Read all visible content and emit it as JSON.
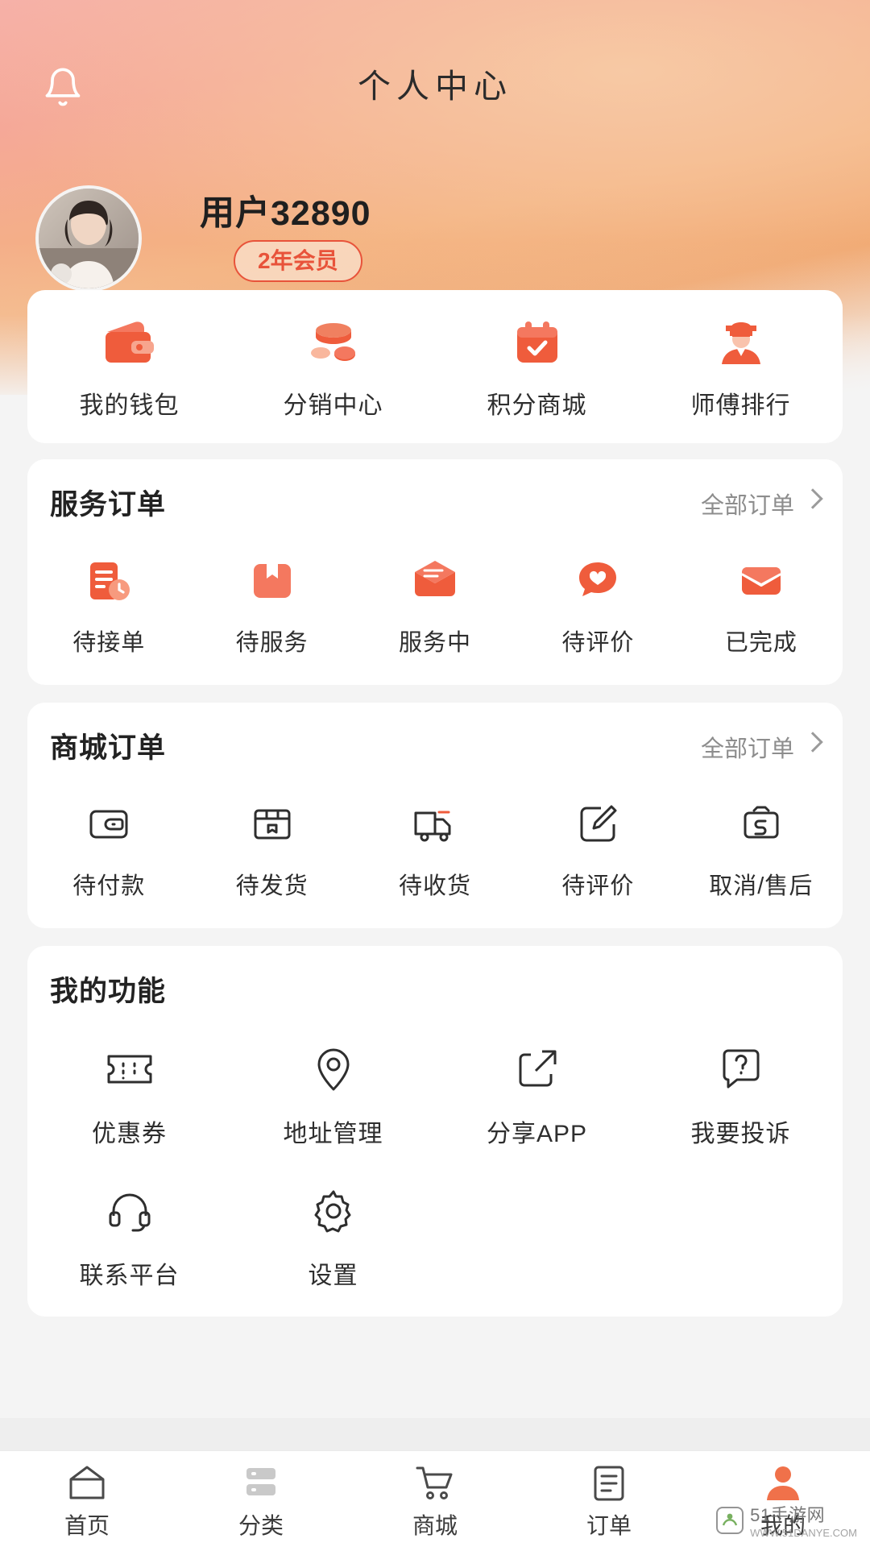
{
  "header": {
    "title": "个人中心",
    "bell_icon": "bell-icon",
    "accent_color": "#e8533a",
    "gradient_from": "#f6b1a8",
    "gradient_to": "#f0a56c"
  },
  "profile": {
    "avatar_icon": "user-avatar",
    "username": "用户32890",
    "badge": "2年会员"
  },
  "quick_actions": [
    {
      "label": "我的钱包",
      "icon": "wallet-icon"
    },
    {
      "label": "分销中心",
      "icon": "coins-icon"
    },
    {
      "label": "积分商城",
      "icon": "points-mall-icon"
    },
    {
      "label": "师傅排行",
      "icon": "worker-rank-icon"
    }
  ],
  "service_orders": {
    "title": "服务订单",
    "more_label": "全部订单",
    "chevron_icon": "chevron-right-icon",
    "items": [
      {
        "label": "待接单",
        "icon": "pending-accept-icon"
      },
      {
        "label": "待服务",
        "icon": "pending-service-icon"
      },
      {
        "label": "服务中",
        "icon": "in-service-icon"
      },
      {
        "label": "待评价",
        "icon": "pending-review-icon"
      },
      {
        "label": "已完成",
        "icon": "completed-icon"
      }
    ]
  },
  "mall_orders": {
    "title": "商城订单",
    "more_label": "全部订单",
    "chevron_icon": "chevron-right-icon",
    "items": [
      {
        "label": "待付款",
        "icon": "wallet-outline-icon"
      },
      {
        "label": "待发货",
        "icon": "package-outline-icon"
      },
      {
        "label": "待收货",
        "icon": "truck-outline-icon"
      },
      {
        "label": "待评价",
        "icon": "edit-outline-icon"
      },
      {
        "label": "取消/售后",
        "icon": "refund-outline-icon"
      }
    ]
  },
  "my_functions": {
    "title": "我的功能",
    "items": [
      {
        "label": "优惠券",
        "icon": "coupon-icon"
      },
      {
        "label": "地址管理",
        "icon": "location-pin-icon"
      },
      {
        "label": "分享APP",
        "icon": "share-icon"
      },
      {
        "label": "我要投诉",
        "icon": "complaint-icon"
      },
      {
        "label": "联系平台",
        "icon": "headset-icon"
      },
      {
        "label": "设置",
        "icon": "gear-icon"
      }
    ]
  },
  "tabbar": {
    "active_index": 4,
    "active_color": "#f0714a",
    "items": [
      {
        "label": "首页",
        "icon": "home-icon"
      },
      {
        "label": "分类",
        "icon": "category-icon"
      },
      {
        "label": "商城",
        "icon": "cart-icon"
      },
      {
        "label": "订单",
        "icon": "order-list-icon"
      },
      {
        "label": "我的",
        "icon": "profile-icon"
      }
    ]
  },
  "watermark": {
    "text": "51手游网",
    "sub": "WWW.51DANYE.COM"
  }
}
